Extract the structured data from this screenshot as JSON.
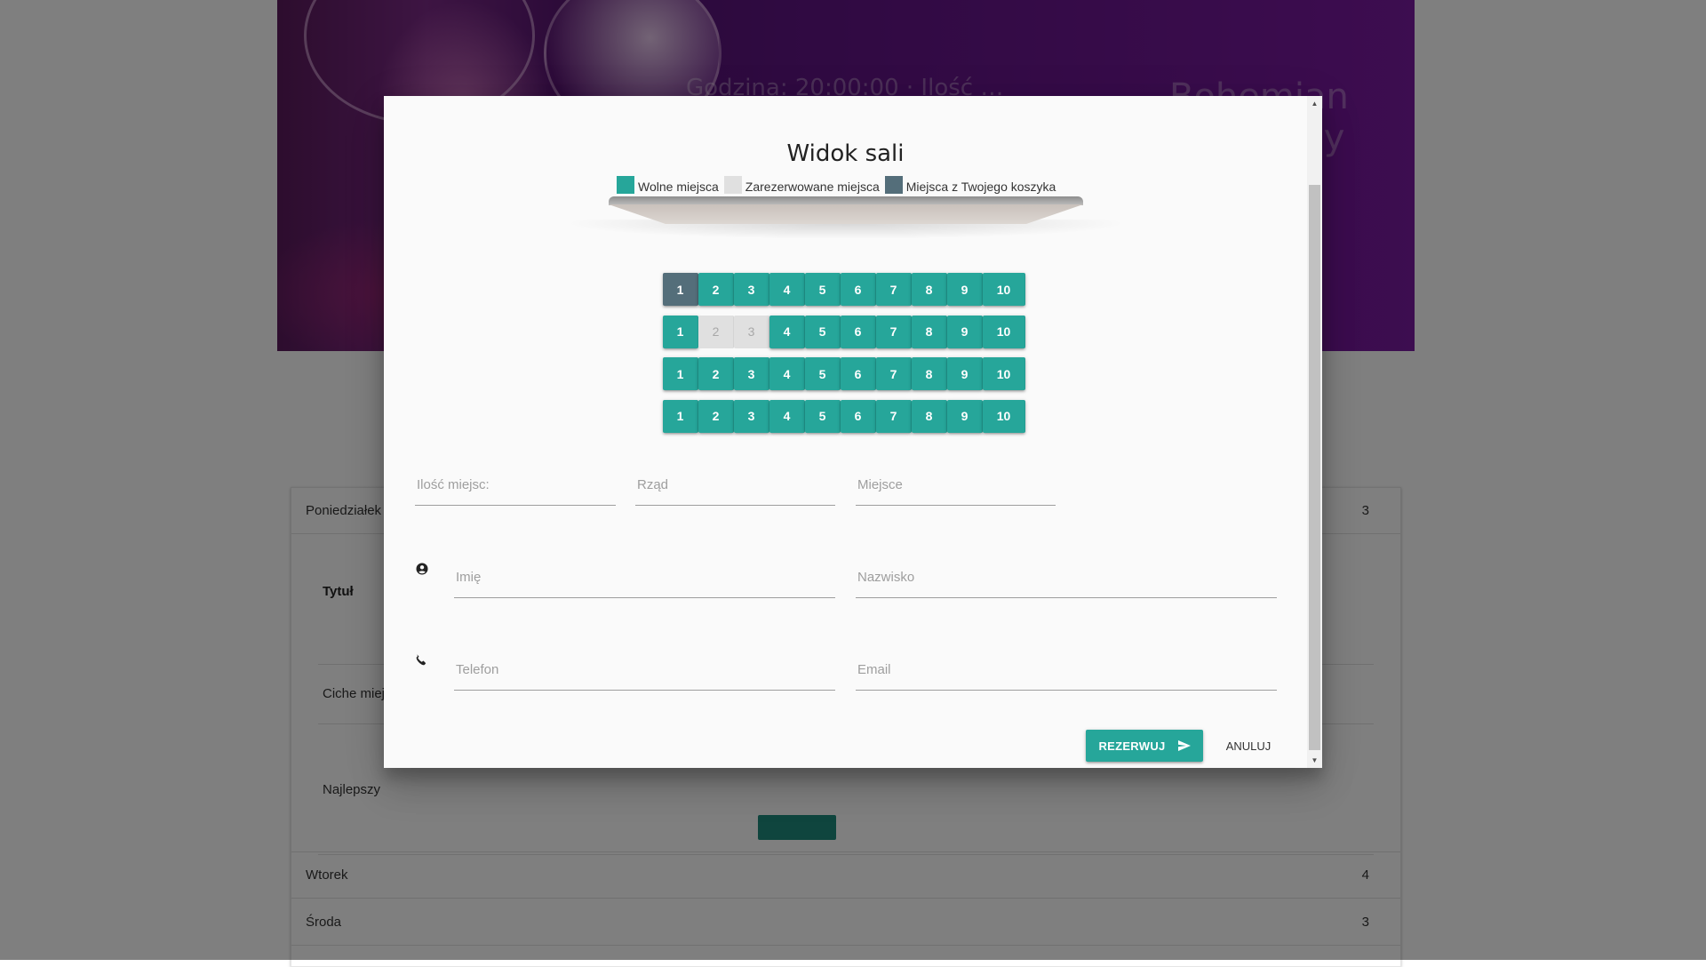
{
  "background": {
    "hero": {
      "breadcrumb": "Godzina: 20:00:00 · Ilość …",
      "movie_title": "Bohemian Rhapsody"
    },
    "schedule": {
      "days": [
        {
          "label": "Poniedziałek",
          "count": "3"
        },
        {
          "label": "Wtorek",
          "count": "4"
        },
        {
          "label": "Środa",
          "count": "3"
        }
      ],
      "table_header": "Tytuł",
      "rows": [
        "Ciche miej",
        "Najlepszy"
      ]
    }
  },
  "modal": {
    "title": "Widok sali",
    "legend": {
      "free": "Wolne miejsca",
      "reserved": "Zarezerwowane miejsca",
      "cart": "Miejsca z Twojego koszyka"
    },
    "colors": {
      "free": "#26a69a",
      "reserved": "#e0e0e0",
      "cart": "#546e7a"
    },
    "seat_rows": [
      [
        {
          "n": "1",
          "s": "cart"
        },
        {
          "n": "2",
          "s": "free"
        },
        {
          "n": "3",
          "s": "free"
        },
        {
          "n": "4",
          "s": "free"
        },
        {
          "n": "5",
          "s": "free"
        },
        {
          "n": "6",
          "s": "free"
        },
        {
          "n": "7",
          "s": "free"
        },
        {
          "n": "8",
          "s": "free"
        },
        {
          "n": "9",
          "s": "free"
        },
        {
          "n": "10",
          "s": "free"
        }
      ],
      [
        {
          "n": "1",
          "s": "free"
        },
        {
          "n": "2",
          "s": "reserved"
        },
        {
          "n": "3",
          "s": "reserved"
        },
        {
          "n": "4",
          "s": "free"
        },
        {
          "n": "5",
          "s": "free"
        },
        {
          "n": "6",
          "s": "free"
        },
        {
          "n": "7",
          "s": "free"
        },
        {
          "n": "8",
          "s": "free"
        },
        {
          "n": "9",
          "s": "free"
        },
        {
          "n": "10",
          "s": "free"
        }
      ],
      [
        {
          "n": "1",
          "s": "free"
        },
        {
          "n": "2",
          "s": "free"
        },
        {
          "n": "3",
          "s": "free"
        },
        {
          "n": "4",
          "s": "free"
        },
        {
          "n": "5",
          "s": "free"
        },
        {
          "n": "6",
          "s": "free"
        },
        {
          "n": "7",
          "s": "free"
        },
        {
          "n": "8",
          "s": "free"
        },
        {
          "n": "9",
          "s": "free"
        },
        {
          "n": "10",
          "s": "free"
        }
      ],
      [
        {
          "n": "1",
          "s": "free"
        },
        {
          "n": "2",
          "s": "free"
        },
        {
          "n": "3",
          "s": "free"
        },
        {
          "n": "4",
          "s": "free"
        },
        {
          "n": "5",
          "s": "free"
        },
        {
          "n": "6",
          "s": "free"
        },
        {
          "n": "7",
          "s": "free"
        },
        {
          "n": "8",
          "s": "free"
        },
        {
          "n": "9",
          "s": "free"
        },
        {
          "n": "10",
          "s": "free"
        }
      ]
    ],
    "form": {
      "seat_count_placeholder": "Ilość miejsc:",
      "row_placeholder": "Rząd",
      "seat_placeholder": "Miejsce",
      "first_name_placeholder": "Imię",
      "last_name_placeholder": "Nazwisko",
      "phone_placeholder": "Telefon",
      "email_placeholder": "Email"
    },
    "actions": {
      "reserve_label": "REZERWUJ",
      "cancel_label": "ANULUJ"
    }
  }
}
